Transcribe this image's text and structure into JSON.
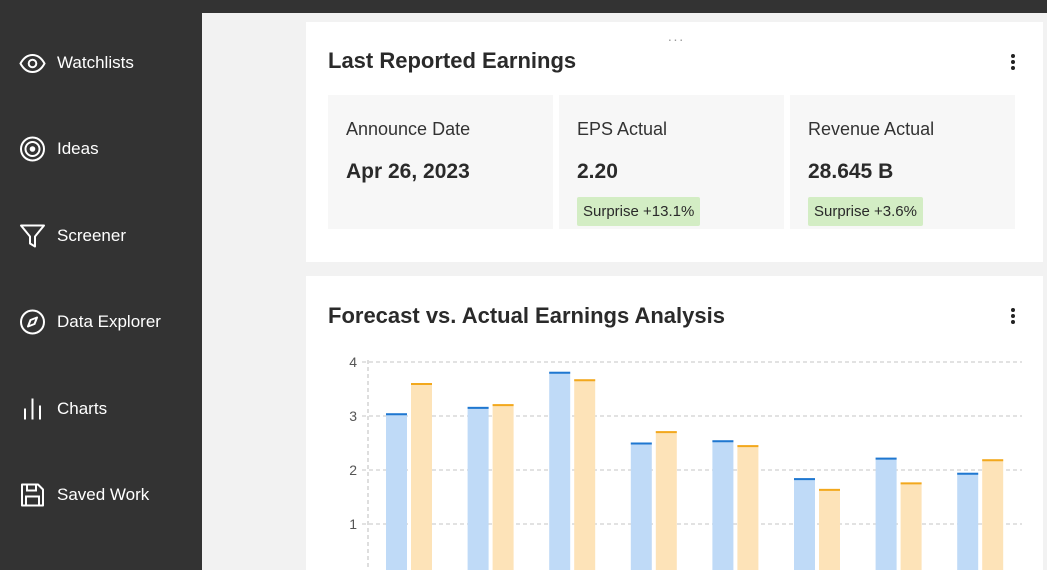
{
  "sidebar": {
    "items": [
      {
        "label": "Watchlists",
        "icon": "eye-icon"
      },
      {
        "label": "Ideas",
        "icon": "target-icon"
      },
      {
        "label": "Screener",
        "icon": "filter-icon"
      },
      {
        "label": "Data Explorer",
        "icon": "compass-icon"
      },
      {
        "label": "Charts",
        "icon": "bar-chart-icon"
      },
      {
        "label": "Saved Work",
        "icon": "save-icon"
      }
    ]
  },
  "earnings_card": {
    "title": "Last Reported Earnings",
    "drag_handle": "···",
    "metrics": [
      {
        "label": "Announce Date",
        "value": "Apr 26, 2023",
        "badge": ""
      },
      {
        "label": "EPS Actual",
        "value": "2.20",
        "badge": "Surprise +13.1%"
      },
      {
        "label": "Revenue Actual",
        "value": "28.645 B",
        "badge": "Surprise +3.6%"
      }
    ]
  },
  "analysis_card": {
    "title": "Forecast vs. Actual Earnings Analysis"
  },
  "colors": {
    "sidebar_bg": "#333333",
    "badge_bg": "#d3edc4",
    "bar_blue_fill": "#bfdaf7",
    "bar_blue_top": "#1f77d0",
    "bar_orange_fill": "#fde3b8",
    "bar_orange_top": "#f2a81d"
  },
  "chart_data": {
    "type": "bar",
    "ylim": [
      0,
      4
    ],
    "yticks": [
      "1",
      "2",
      "3",
      "4"
    ],
    "grid": true,
    "series": [
      {
        "values": [
          3.05,
          3.17,
          3.82,
          2.51,
          2.55,
          1.85,
          2.23,
          1.95
        ]
      },
      {
        "values": [
          3.61,
          3.22,
          3.68,
          2.72,
          2.46,
          1.65,
          1.77,
          2.2
        ]
      }
    ]
  }
}
